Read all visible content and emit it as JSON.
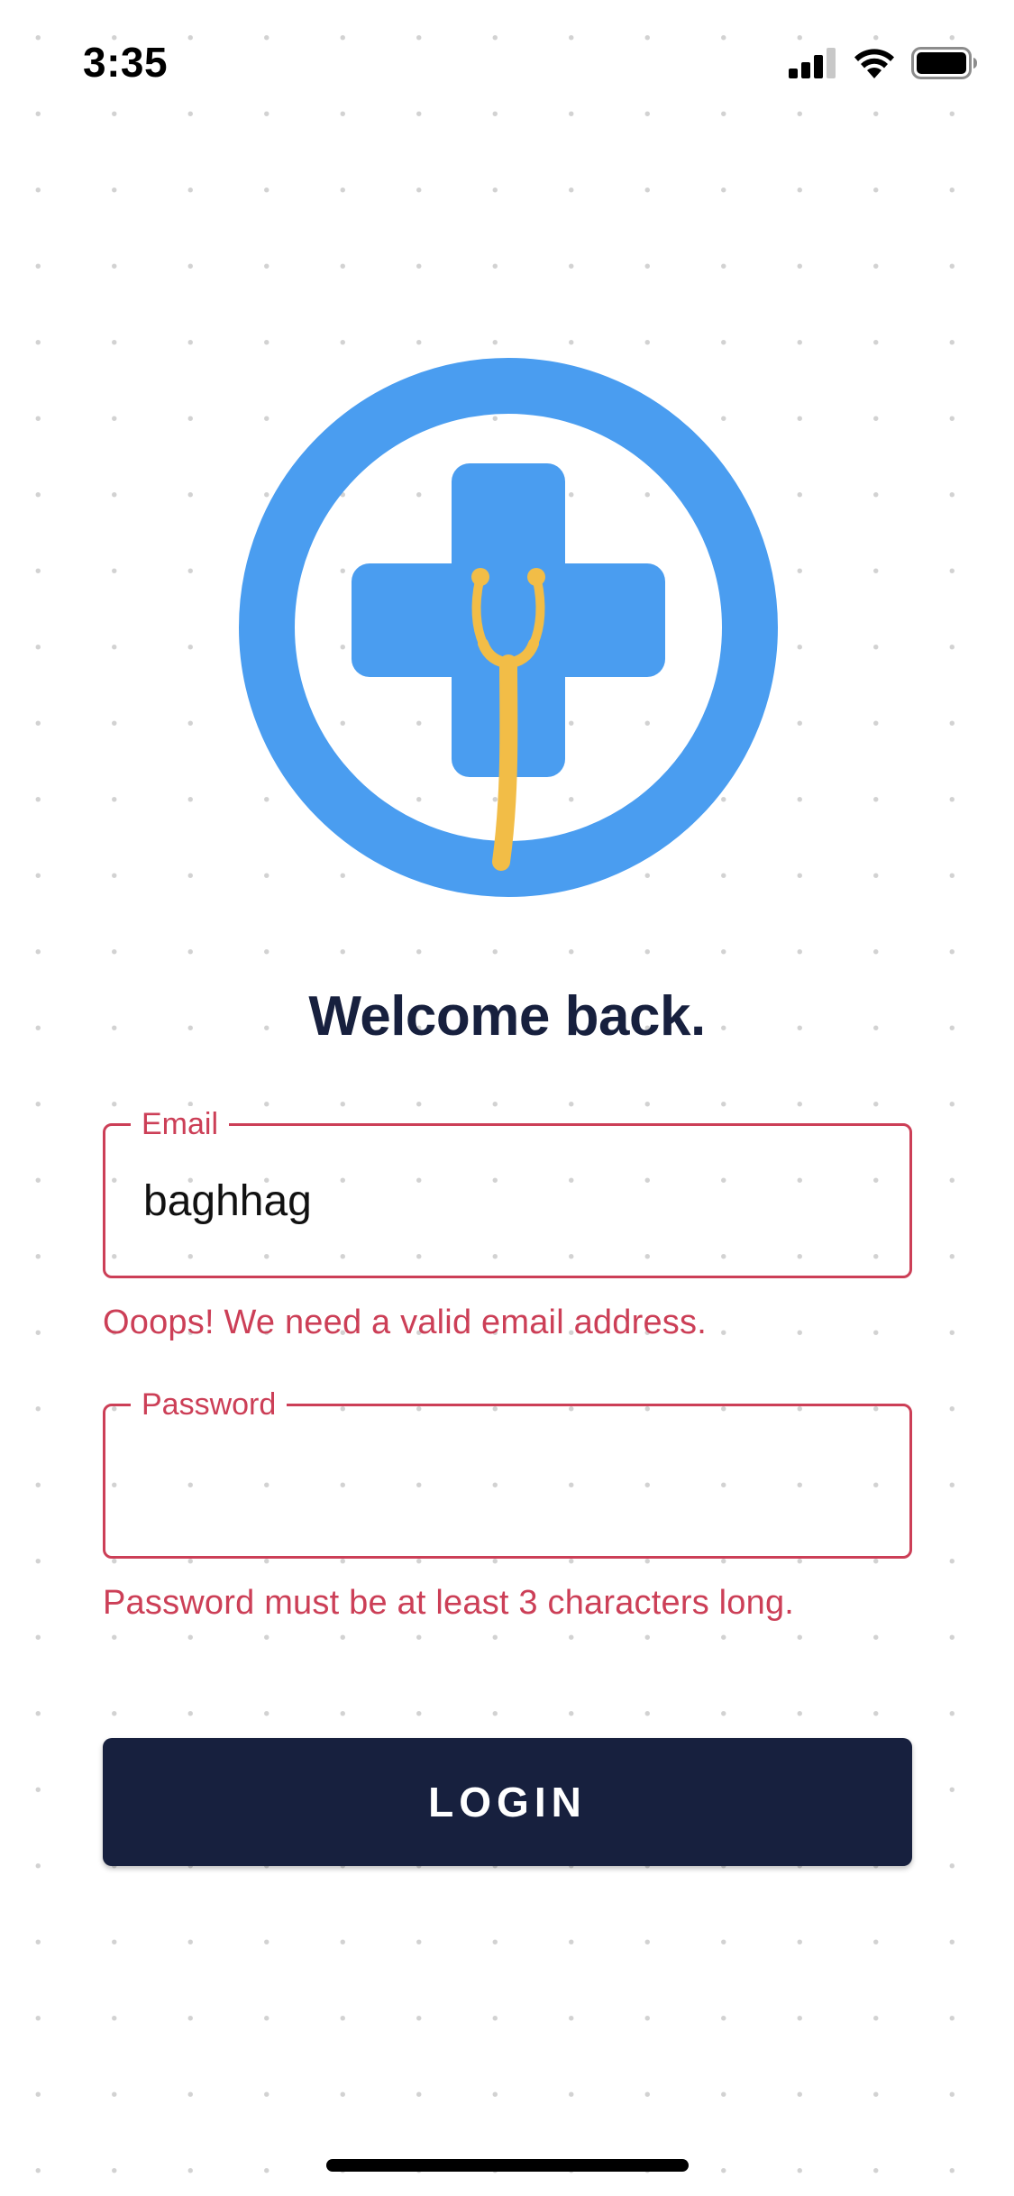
{
  "status_bar": {
    "time": "3:35",
    "icons": [
      "cellular-signal-icon",
      "wifi-icon",
      "battery-icon"
    ]
  },
  "logo": {
    "icon": "medical-cross-stethoscope-logo",
    "ring_color": "#4a9df0",
    "cross_color": "#4a9df0",
    "stethoscope_color": "#f2bd47"
  },
  "heading": "Welcome back.",
  "form": {
    "email": {
      "label": "Email",
      "value": "baghhag",
      "error": "Ooops! We need a valid email address."
    },
    "password": {
      "label": "Password",
      "value": "",
      "error": "Password must be at least 3 characters long."
    },
    "login_label": "LOGIN"
  },
  "colors": {
    "primary": "#17203e",
    "error": "#cc3f57",
    "background": "#ffffff"
  }
}
